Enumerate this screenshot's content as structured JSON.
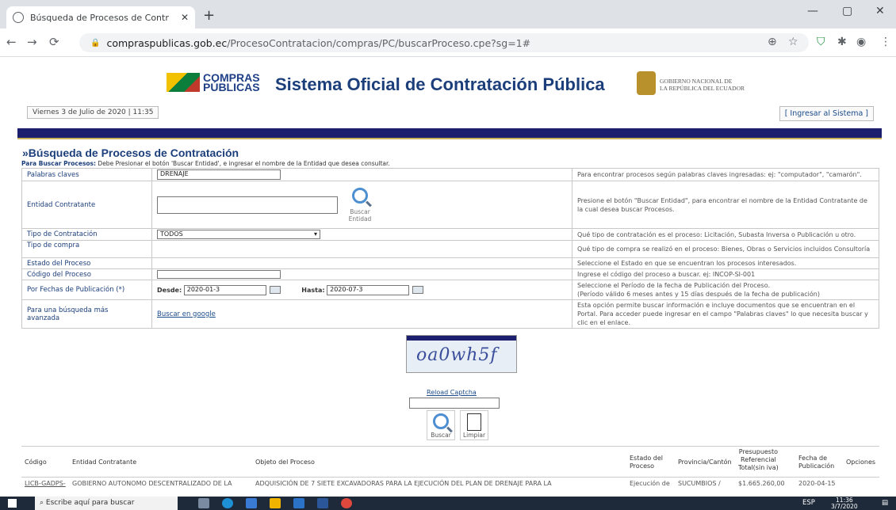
{
  "browser": {
    "tab_title": "Búsqueda de Procesos de Contr",
    "url_host": "compraspublicas.gob.ec",
    "url_path": "/ProcesoContratacion/compras/PC/buscarProceso.cpe?sg=1#"
  },
  "header": {
    "logo_line1": "COMPRAS",
    "logo_line2": "PÚBLICAS",
    "title": "Sistema Oficial de Contratación Pública",
    "gov_line1": "GOBIERNO NACIONAL DE",
    "gov_line2": "LA REPÚBLICA DEL ECUADOR",
    "date": "Viernes 3 de Julio de 2020 | 11:35",
    "login": "[ Ingresar al Sistema ]"
  },
  "search": {
    "title": "»Búsqueda de Procesos de Contratación",
    "instr_bold": "Para Buscar Procesos:",
    "instr_text": " Debe Presionar el botón 'Buscar Entidad', e ingresar el nombre de la Entidad que desea consultar.",
    "rows": {
      "keywords": {
        "label": "Palabras claves",
        "value": "DRENAJE",
        "help": "Para encontrar procesos según palabras claves ingresadas: ej: \"computador\", \"camarón\"."
      },
      "entity": {
        "label": "Entidad Contratante",
        "btn": "Buscar",
        "btn2": "Entidad",
        "help": "Presione el botón \"Buscar Entidad\", para encontrar el nombre de la Entidad Contratante de la cual desea buscar Procesos."
      },
      "type": {
        "label": "Tipo de Contratación",
        "value": "TODOS",
        "help": "Qué tipo de contratación es el proceso: Licitación, Subasta Inversa o Publicación u otro."
      },
      "purchase": {
        "label": "Tipo de compra",
        "help": "Qué tipo de compra se realizó en el proceso: Bienes, Obras o Servicios incluidos Consultoría"
      },
      "state": {
        "label": "Estado del Proceso",
        "help": "Seleccione el Estado en que se encuentran los procesos interesados."
      },
      "code": {
        "label": "Código del Proceso",
        "help": "Ingrese el código del proceso a buscar. ej: INCOP-SI-001"
      },
      "dates": {
        "label": "Por Fechas de Publicación (*)",
        "from_label": "Desde:",
        "from": "2020-01-3",
        "to_label": "Hasta:",
        "to": "2020-07-3",
        "help1": "Seleccione el Período de la fecha de Publicación del Proceso.",
        "help2": "(Período válido 6 meses antes y 15 días después de la fecha de publicación)"
      },
      "advanced": {
        "label1": "Para una búsqueda más",
        "label2": "avanzada",
        "link": "Buscar en google",
        "help": "Esta opción permite buscar información e incluye documentos que se encuentran en el Portal. Para acceder puede ingresar en el campo \"Palabras claves\" lo que necesita buscar y clic en el enlace."
      }
    },
    "captcha_text": "oa0wh5f",
    "reload": "Reload Captcha",
    "buscar": "Buscar",
    "limpiar": "Limpiar"
  },
  "results": {
    "headers": {
      "code": "Código",
      "entity": "Entidad Contratante",
      "object": "Objeto del Proceso",
      "state1": "Estado del",
      "state2": "Proceso",
      "prov": "Provincia/Cantón",
      "budget1": "Presupuesto",
      "budget2": "Referencial",
      "budget3": "Total(sin iva)",
      "date1": "Fecha de",
      "date2": "Publicación",
      "options": "Opciones"
    },
    "row": {
      "code": "LICB-GADPS-",
      "entity": "GOBIERNO AUTONOMO DESCENTRALIZADO DE LA",
      "object": "ADQUISICIÓN DE 7 SIETE EXCAVADORAS PARA LA EJECUCIÓN DEL PLAN DE DRENAJE PARA LA",
      "state": "Ejecución de",
      "prov": "SUCUMBIOS /",
      "budget": "$1.665.260,00",
      "date": "2020-04-15"
    }
  },
  "taskbar": {
    "search": "Escribe aquí para buscar",
    "lang": "ESP",
    "time": "11:36",
    "date": "3/7/2020"
  }
}
